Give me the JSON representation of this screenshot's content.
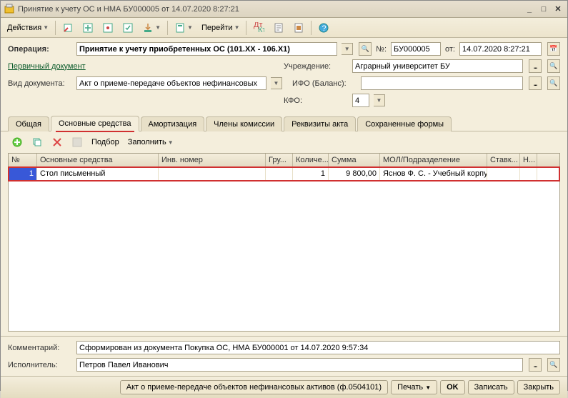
{
  "window": {
    "title": "Принятие к учету ОС и НМА БУ000005 от 14.07.2020 8:27:21"
  },
  "toolbar": {
    "actions": "Действия",
    "goto": "Перейти"
  },
  "header": {
    "operation_lbl": "Операция:",
    "operation_val": "Принятие к учету приобретенных ОС (101.ХХ - 106.Х1)",
    "num_lbl": "№:",
    "num_val": "БУ000005",
    "date_lbl": "от:",
    "date_val": "14.07.2020 8:27:21",
    "primary_doc": "Первичный документ",
    "uchr_lbl": "Учреждение:",
    "uchr_val": "Аграрный университет БУ",
    "doc_type_lbl": "Вид документа:",
    "doc_type_val": "Акт о приеме-передаче объектов нефинансовых",
    "ifo_lbl": "ИФО (Баланс):",
    "ifo_val": "",
    "kfo_lbl": "КФО:",
    "kfo_val": "4"
  },
  "tabs": [
    "Общая",
    "Основные средства",
    "Амортизация",
    "Члены комиссии",
    "Реквизиты акта",
    "Сохраненные формы"
  ],
  "subtb": {
    "podbor": "Подбор",
    "fill": "Заполнить"
  },
  "grid": {
    "cols": [
      "№",
      "Основные средства",
      "Инв. номер",
      "Гру...",
      "Количе...",
      "Сумма",
      "МОЛ/Подразделение",
      "Ставк...",
      "Н..."
    ],
    "widths": [
      40,
      170,
      150,
      38,
      50,
      72,
      150,
      46,
      24
    ],
    "row": {
      "n": "1",
      "name": "Стол письменный",
      "inv": "",
      "grp": "",
      "qty": "1",
      "sum": "9 800,00",
      "mol": "Яснов Ф. С. - Учебный корпус",
      "rate": "",
      "tax": ""
    }
  },
  "footer": {
    "comment_lbl": "Комментарий:",
    "comment_val": "Сформирован из документа Покупка ОС, НМА БУ000001 от 14.07.2020 9:57:34",
    "exec_lbl": "Исполнитель:",
    "exec_val": "Петров Павел Иванович"
  },
  "btnbar": {
    "act_name": "Акт о приеме-передаче объектов нефинансовых активов (ф.0504101)",
    "print": "Печать",
    "ok": "OK",
    "save": "Записать",
    "close": "Закрыть"
  }
}
